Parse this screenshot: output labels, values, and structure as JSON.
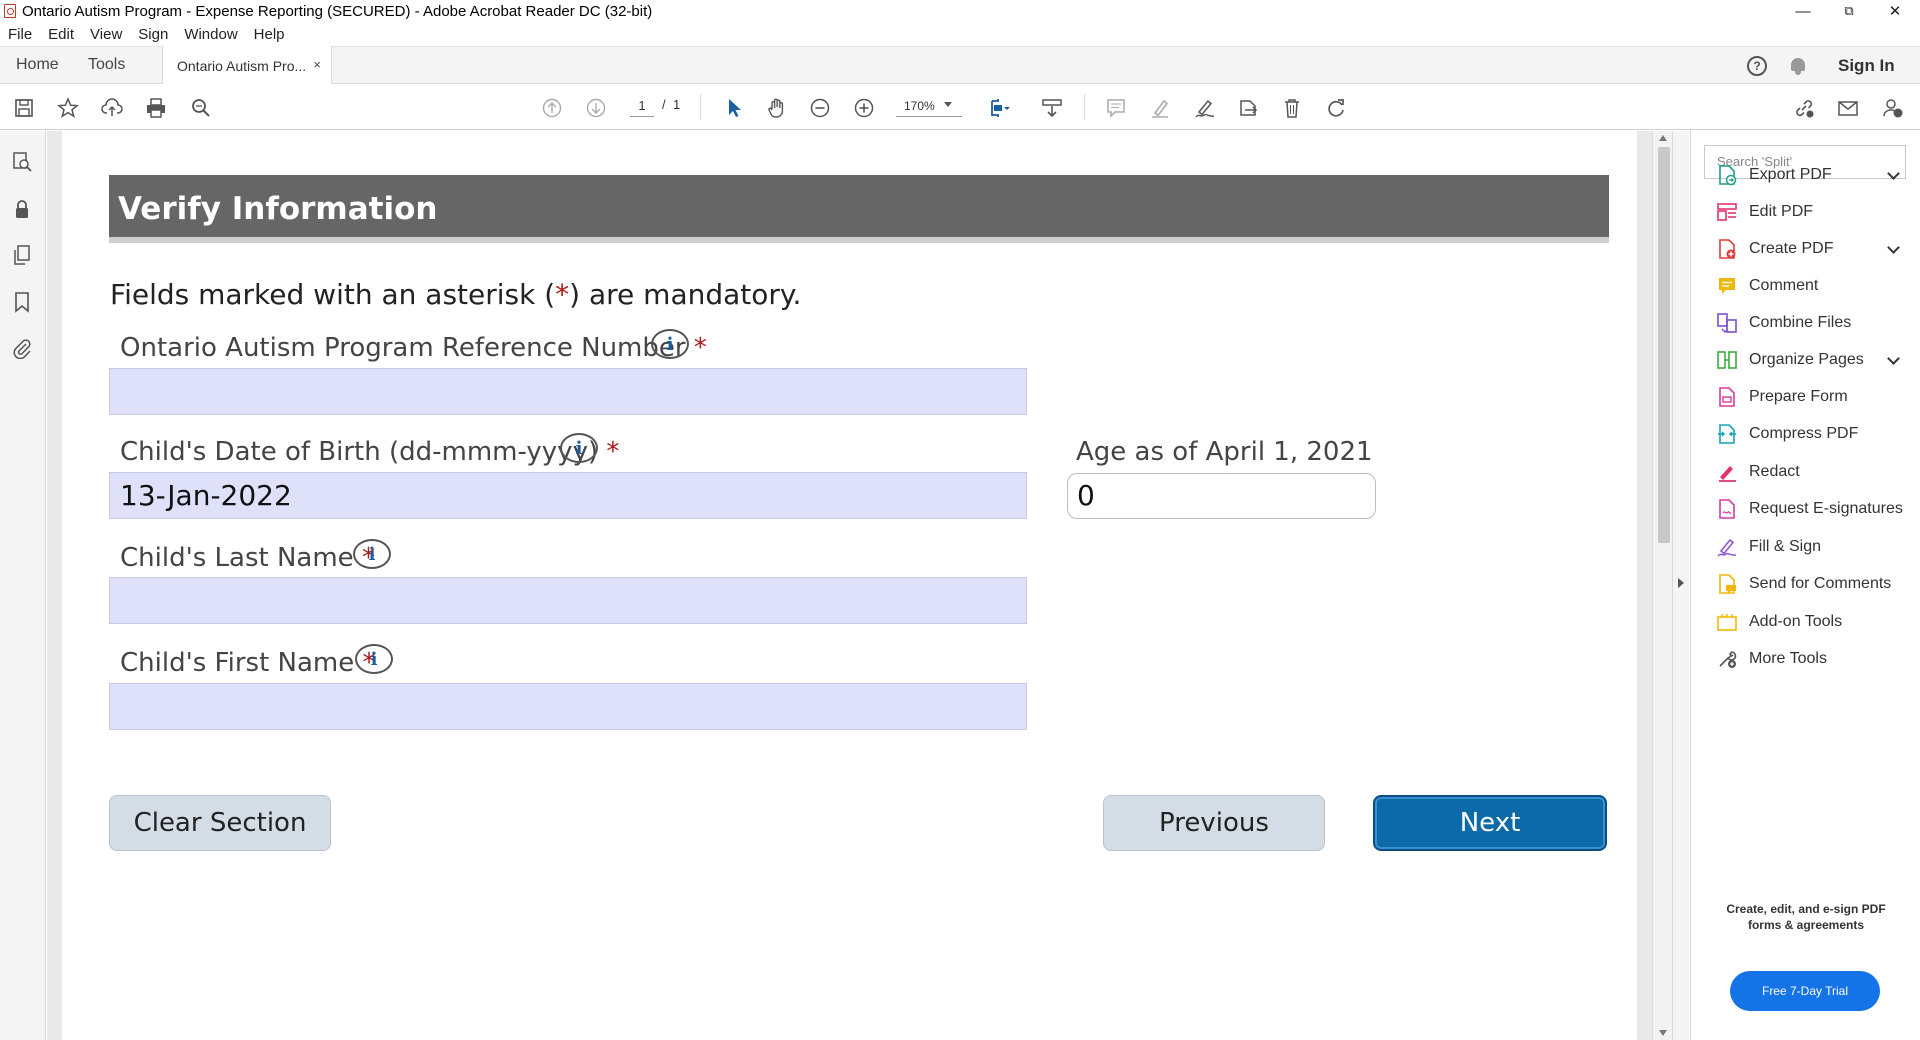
{
  "window": {
    "title": "Ontario Autism Program - Expense Reporting (SECURED) - Adobe Acrobat Reader DC (32-bit)",
    "minimize_glyph": "—",
    "restore_glyph": "⧉",
    "close_glyph": "✕"
  },
  "menu": [
    "File",
    "Edit",
    "View",
    "Sign",
    "Window",
    "Help"
  ],
  "tabs": {
    "home": "Home",
    "tools": "Tools",
    "document": "Ontario Autism Pro...",
    "close_glyph": "×"
  },
  "header_right": {
    "help_glyph": "?",
    "sign_in": "Sign In"
  },
  "toolbar": {
    "page_current": "1",
    "page_sep": "/",
    "page_total": "1",
    "zoom": "170%"
  },
  "form": {
    "section_title": "Verify Information",
    "mandatory_prefix": "Fields marked with an asterisk (",
    "mandatory_asterisk": "*",
    "mandatory_suffix": ") are mandatory.",
    "asterisk": "*",
    "info_glyph": "i",
    "reference_label": "Ontario Autism Program Reference Number",
    "reference_value": "",
    "dob_label": "Child's Date of Birth (dd-mmm-yyyy)",
    "dob_value": "13-Jan-2022",
    "age_label": "Age as of April 1, 2021",
    "age_value": "0",
    "last_name_label": "Child's Last Name",
    "last_name_value": "",
    "first_name_label": "Child's First Name",
    "first_name_value": "",
    "clear_button": "Clear Section",
    "previous_button": "Previous",
    "next_button": "Next"
  },
  "right_panel": {
    "search_placeholder": "Search 'Split'",
    "items": [
      {
        "label": "Export PDF",
        "icon": "export-pdf-icon",
        "color": "#1e9e8c",
        "expandable": true
      },
      {
        "label": "Edit PDF",
        "icon": "edit-pdf-icon",
        "color": "#e0356b",
        "expandable": false
      },
      {
        "label": "Create PDF",
        "icon": "create-pdf-icon",
        "color": "#e03c3c",
        "expandable": true
      },
      {
        "label": "Comment",
        "icon": "comment-icon",
        "color": "#f2b705",
        "expandable": false
      },
      {
        "label": "Combine Files",
        "icon": "combine-files-icon",
        "color": "#7b4fd1",
        "expandable": false
      },
      {
        "label": "Organize Pages",
        "icon": "organize-pages-icon",
        "color": "#3eaa3e",
        "expandable": true
      },
      {
        "label": "Prepare Form",
        "icon": "prepare-form-icon",
        "color": "#d63aa0",
        "expandable": false
      },
      {
        "label": "Compress PDF",
        "icon": "compress-pdf-icon",
        "color": "#1aa0b8",
        "expandable": false
      },
      {
        "label": "Redact",
        "icon": "redact-icon",
        "color": "#e0356b",
        "expandable": false
      },
      {
        "label": "Request E-signatures",
        "icon": "request-esignatures-icon",
        "color": "#d63aa0",
        "expandable": false
      },
      {
        "label": "Fill & Sign",
        "icon": "fill-sign-icon",
        "color": "#8a4fd1",
        "expandable": false
      },
      {
        "label": "Send for Comments",
        "icon": "send-for-comments-icon",
        "color": "#f2b705",
        "expandable": false
      },
      {
        "label": "Add-on Tools",
        "icon": "add-on-tools-icon",
        "color": "#f2b705",
        "expandable": false
      },
      {
        "label": "More Tools",
        "icon": "more-tools-icon",
        "color": "#555555",
        "expandable": false
      }
    ],
    "promo_line1": "Create, edit, and e-sign PDF",
    "promo_line2": "forms & agreements",
    "trial_button": "Free 7-Day Trial"
  },
  "colors": {
    "accent_blue": "#0d6aa8",
    "field_fill": "#dfe1fb",
    "section_header": "#666666",
    "asterisk_red": "#b01818"
  }
}
